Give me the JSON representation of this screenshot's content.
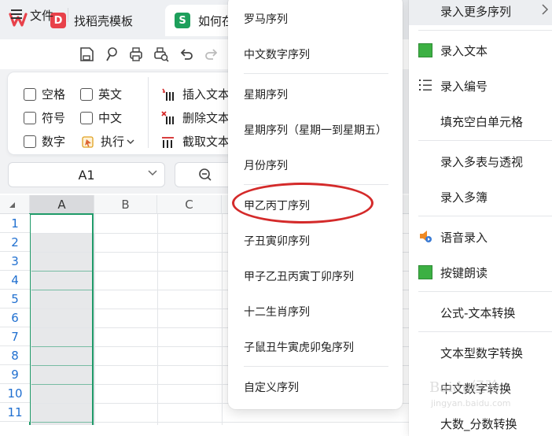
{
  "tabs": [
    {
      "label": "找稻壳模板",
      "icon": "docer-icon"
    },
    {
      "label": "如何在",
      "icon": "spreadsheet-icon"
    }
  ],
  "toolbar": {
    "file_label": "文件"
  },
  "ribbon": {
    "checkboxes": [
      "空格",
      "英文",
      "符号",
      "中文",
      "数字"
    ],
    "execute_label": "执行",
    "actions": [
      "插入文本",
      "删除文本",
      "截取文本"
    ]
  },
  "namebox": {
    "value": "A1"
  },
  "grid": {
    "columns": [
      "A",
      "B",
      "C"
    ],
    "rows": [
      "1",
      "2",
      "3",
      "4",
      "5",
      "6",
      "7",
      "8",
      "9",
      "10",
      "11"
    ]
  },
  "submenu": {
    "items": [
      "罗马序列",
      "中文数字序列",
      "星期序列",
      "星期序列（星期一到星期五）",
      "月份序列",
      "甲乙丙丁序列",
      "子丑寅卯序列",
      "甲子乙丑丙寅丁卯序列",
      "十二生肖序列",
      "子鼠丑牛寅虎卯兔序列",
      "自定义序列"
    ],
    "highlighted": "甲乙丙丁序列",
    "highlight_color": "#d42a2a"
  },
  "mainmenu": {
    "items": [
      "录入更多序列",
      "录入文本",
      "录入编号",
      "填充空白单元格",
      "录入多表与透视",
      "录入多簿",
      "语音录入",
      "按键朗读",
      "公式-文本转换",
      "文本型数字转换",
      "中文数字转换",
      "大数_分数转换"
    ]
  },
  "watermark": {
    "line1": "Baidu经验",
    "line2": "jingyan.baidu.com"
  },
  "colors": {
    "accent": "#1f9a69",
    "wps_red": "#e8414a",
    "sheet_green": "#1d9f5b"
  }
}
